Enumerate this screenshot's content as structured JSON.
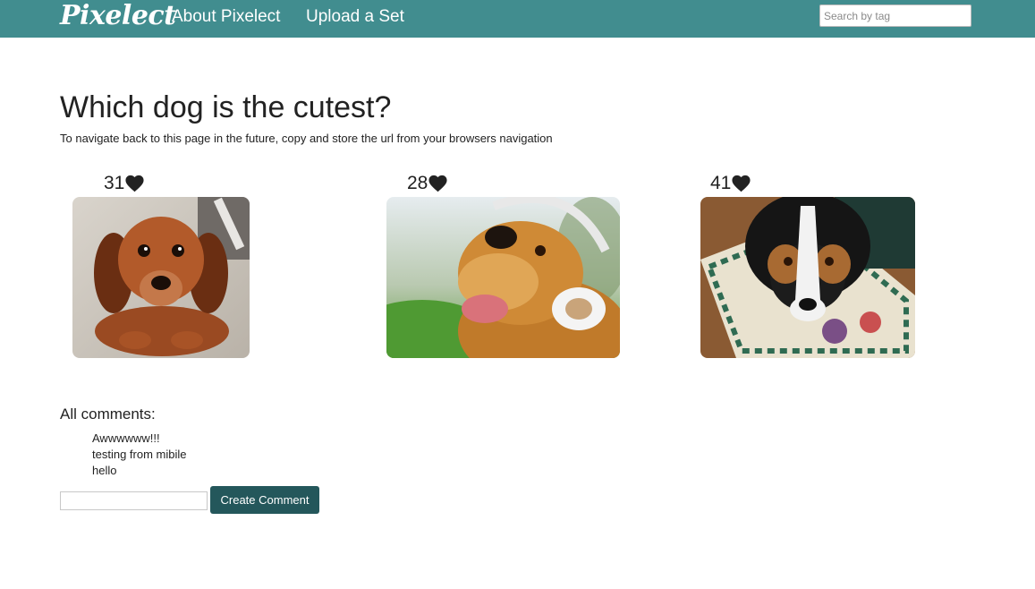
{
  "nav": {
    "brand": "Pixelect",
    "links": [
      "About Pixelect",
      "Upload a Set"
    ],
    "search_placeholder": "Search by tag"
  },
  "page": {
    "title": "Which dog is the cutest?",
    "subtitle": "To navigate back to this page in the future, copy and store the url from your browsers navigation"
  },
  "options": [
    {
      "votes": "31",
      "photo": "dachshund puppy lying on floor",
      "icon": "heart-icon"
    },
    {
      "votes": "28",
      "photo": "golden retriever wearing headphones",
      "icon": "heart-icon"
    },
    {
      "votes": "41",
      "photo": "border collie on patterned rug",
      "icon": "heart-icon"
    }
  ],
  "comments": {
    "title": "All comments:",
    "items": [
      "Awwwwww!!!",
      "testing from mibile",
      "hello"
    ],
    "input_value": "",
    "button_label": "Create Comment"
  },
  "colors": {
    "navbar": "#418d8f",
    "button": "#24575b",
    "text": "#222222"
  }
}
